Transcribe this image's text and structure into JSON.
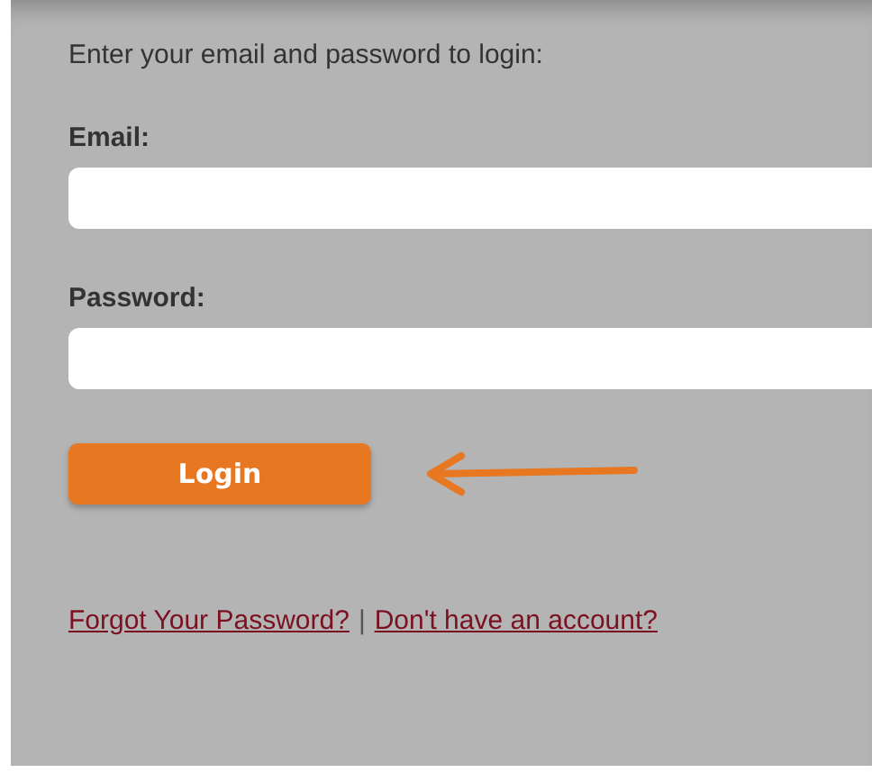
{
  "instructions": "Enter your email and password to login:",
  "fields": [
    {
      "label": "Email:"
    },
    {
      "label": "Password:"
    }
  ],
  "login_button": "Login",
  "links": [
    {
      "text": "Forgot Your Password?"
    },
    {
      "text": "Don't have an account?"
    }
  ],
  "separator": "|"
}
